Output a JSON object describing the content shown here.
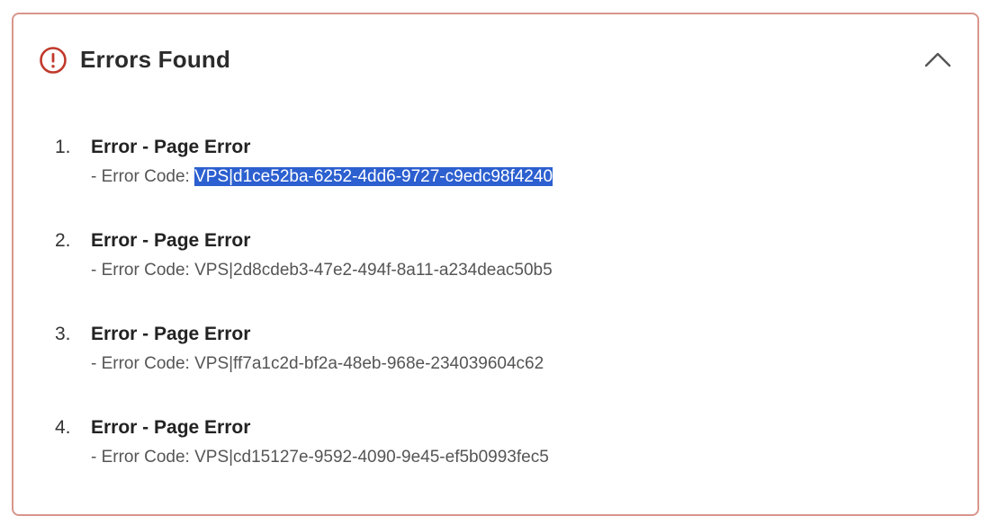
{
  "panel": {
    "title": "Errors Found",
    "accent_color": "#c0392b",
    "border_color": "#d9968c",
    "icon": "exclamation-circle-icon",
    "collapse_icon": "chevron-up-icon"
  },
  "errors": [
    {
      "number": "1.",
      "title": "Error - Page Error",
      "code_prefix": "- Error Code: ",
      "code": "VPS|d1ce52ba-6252-4dd6-9727-c9edc98f4240",
      "selected": true
    },
    {
      "number": "2.",
      "title": "Error - Page Error",
      "code_prefix": "- Error Code: ",
      "code": "VPS|2d8cdeb3-47e2-494f-8a11-a234deac50b5",
      "selected": false
    },
    {
      "number": "3.",
      "title": "Error - Page Error",
      "code_prefix": "- Error Code: ",
      "code": "VPS|ff7a1c2d-bf2a-48eb-968e-234039604c62",
      "selected": false
    },
    {
      "number": "4.",
      "title": "Error - Page Error",
      "code_prefix": "- Error Code: ",
      "code": "VPS|cd15127e-9592-4090-9e45-ef5b0993fec5",
      "selected": false
    }
  ],
  "selection_color": "#2c5fcf"
}
